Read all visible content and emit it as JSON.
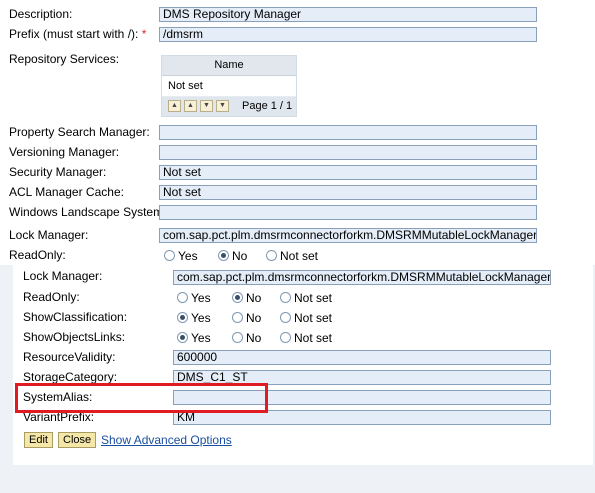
{
  "repository": {
    "description_label": "Description:",
    "description_value": "DMS Repository Manager",
    "prefix_label": "Prefix (must start with /):",
    "prefix_required": "*",
    "prefix_value": "/dmsrm",
    "services_label": "Repository Services:",
    "services_table": {
      "header": "Name",
      "rows": [
        "Not set"
      ],
      "page_info": "Page 1 / 1",
      "pager_buttons": [
        "first-page-icon",
        "previous-page-icon",
        "next-page-icon",
        "last-page-icon"
      ]
    },
    "property_search_label": "Property Search Manager:",
    "property_search_value": "",
    "versioning_label": "Versioning Manager:",
    "versioning_value": "",
    "security_label": "Security Manager:",
    "security_value": "Not set",
    "acl_label": "ACL Manager Cache:",
    "acl_value": "Not set",
    "windows_label": "Windows Landscape System:",
    "windows_value": "",
    "lock_label": "Lock Manager:",
    "lock_value": "com.sap.pct.plm.dmsrmconnectorforkm.DMSRMMutableLockManager",
    "readonly_label": "ReadOnly:",
    "readonly_options": [
      "Yes",
      "No",
      "Not set"
    ],
    "readonly_selected": "No"
  },
  "lock_manager_settings": {
    "lock_label": "Lock Manager:",
    "lock_value": "com.sap.pct.plm.dmsrmconnectorforkm.DMSRMMutableLockManager",
    "readonly_label": "ReadOnly:",
    "readonly_options": [
      "Yes",
      "No",
      "Not set"
    ],
    "readonly_selected": "No",
    "showclass_label": "ShowClassification:",
    "showclass_options": [
      "Yes",
      "No",
      "Not set"
    ],
    "showclass_selected": "Yes",
    "showobj_label": "ShowObjectsLinks:",
    "showobj_options": [
      "Yes",
      "No",
      "Not set"
    ],
    "showobj_selected": "Yes",
    "validity_label": "ResourceValidity:",
    "validity_value": "600000",
    "storage_label": "StorageCategory:",
    "storage_value": "DMS_C1_ST",
    "systemalias_label": "SystemAlias:",
    "systemalias_value": "",
    "variant_label": "VariantPrefix:",
    "variant_value": "KM",
    "edit_button": "Edit",
    "close_button": "Close",
    "advanced_link": "Show Advanced Options"
  },
  "colors": {
    "highlight_box": "#e01b22",
    "field_background": "#e5eef8",
    "button_background": "#f5e7a8",
    "link": "#1a4fa0"
  }
}
